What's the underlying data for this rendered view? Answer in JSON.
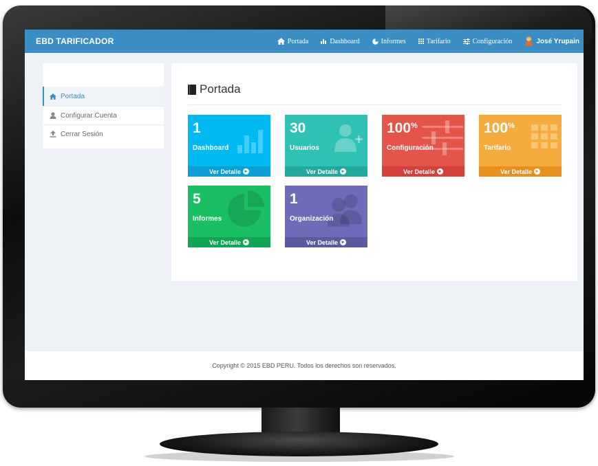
{
  "app": {
    "brand": "EBD TARIFICADOR"
  },
  "nav": {
    "items": [
      {
        "label": "Portada",
        "icon": "home-icon"
      },
      {
        "label": "Dashboard",
        "icon": "bar-chart-icon"
      },
      {
        "label": "Informes",
        "icon": "pie-chart-icon"
      },
      {
        "label": "Tarifario",
        "icon": "grid-icon"
      },
      {
        "label": "Configuración",
        "icon": "sliders-icon"
      }
    ],
    "user": {
      "name": "José Yrupain",
      "icon": "user-avatar-icon"
    }
  },
  "sidebar": {
    "items": [
      {
        "label": "Portada",
        "icon": "home-icon",
        "active": true
      },
      {
        "label": "Configurar Cuenta",
        "icon": "user-icon",
        "active": false
      },
      {
        "label": "Cerrar Sesión",
        "icon": "upload-icon",
        "active": false
      }
    ]
  },
  "main": {
    "title": "Portada",
    "tiles": [
      {
        "value": "1",
        "suffix": "",
        "label": "Dashboard",
        "link": "Ver Detalle",
        "color": "#00b9f1",
        "foot_color": "#0aa0d6",
        "icon": "bar-chart-icon"
      },
      {
        "value": "30",
        "suffix": "",
        "label": "Usuarios",
        "link": "Ver Detalle",
        "color": "#2ec1b4",
        "foot_color": "#22a99d",
        "icon": "add-user-icon"
      },
      {
        "value": "100",
        "suffix": "%",
        "label": "Configuración",
        "link": "Ver Detalle",
        "color": "#e4544a",
        "foot_color": "#d4403a",
        "icon": "sliders-icon"
      },
      {
        "value": "100",
        "suffix": "%",
        "label": "Tarifario",
        "link": "Ver Detalle",
        "color": "#f6ac3d",
        "foot_color": "#e8901e",
        "icon": "grid-icon"
      },
      {
        "value": "5",
        "suffix": "",
        "label": "Informes",
        "link": "Ver Detalle",
        "color": "#1bbf63",
        "foot_color": "#12a553",
        "icon": "pie-chart-icon"
      },
      {
        "value": "1",
        "suffix": "",
        "label": "Organización",
        "link": "Ver Detalle",
        "color": "#6c6cb8",
        "foot_color": "#5a5aa0",
        "icon": "group-icon"
      }
    ]
  },
  "footer": {
    "text": "Copyright © 2015 EBD PERU. Todos los derechos son reservados."
  }
}
